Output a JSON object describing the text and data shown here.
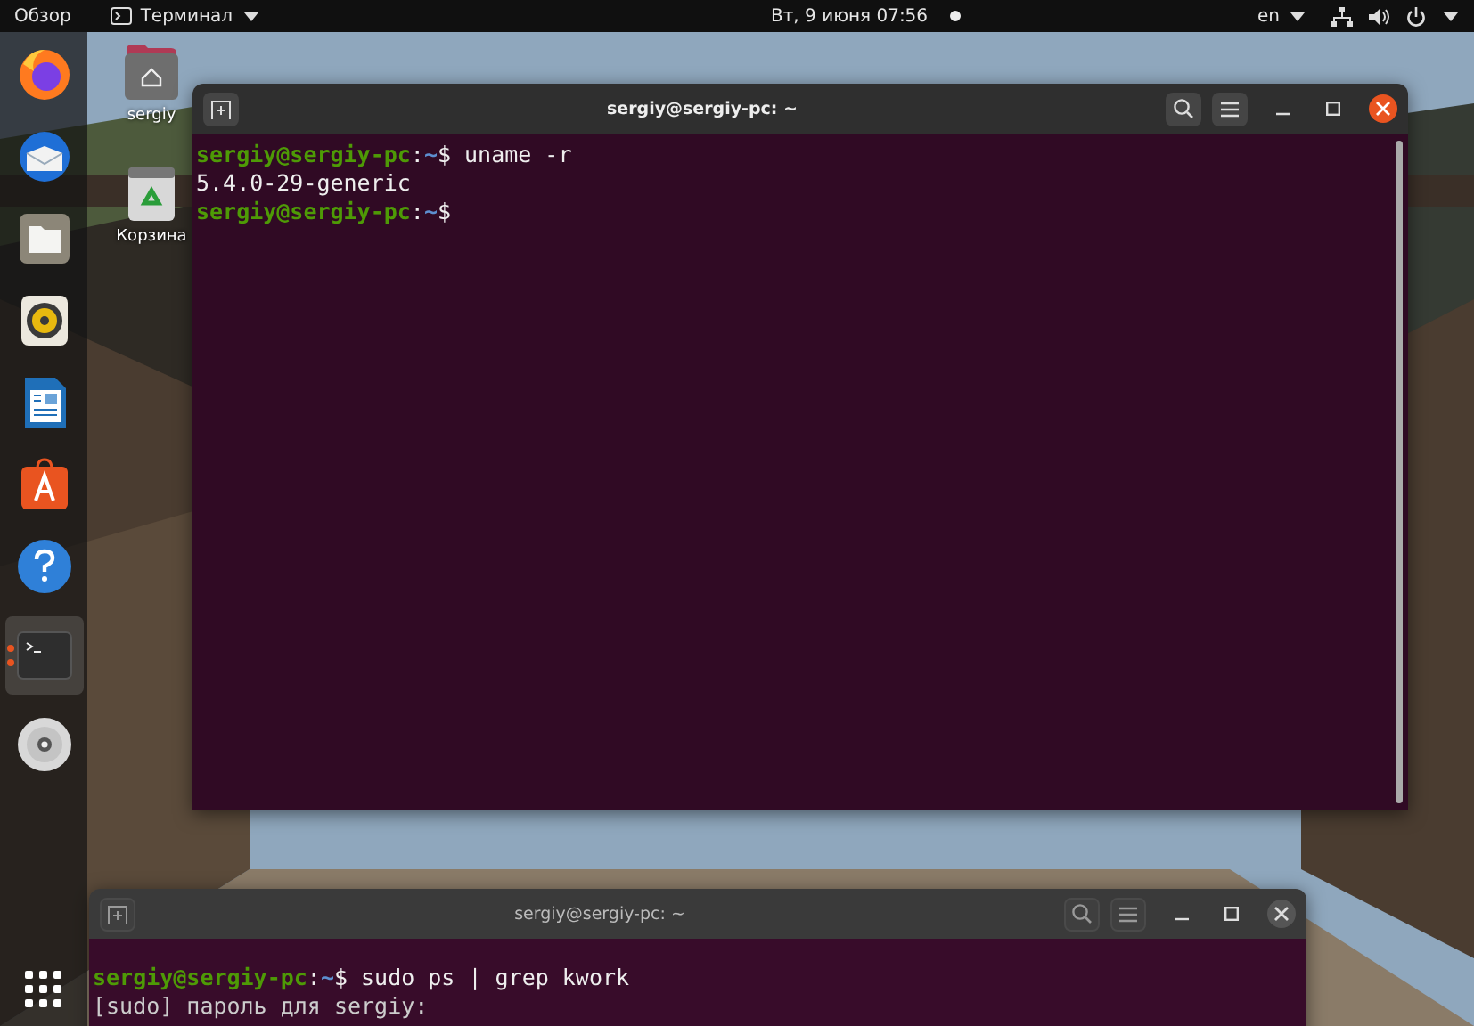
{
  "top_bar": {
    "activities": "Обзор",
    "app_menu": "Терминал",
    "clock": "Вт, 9 июня  07:56",
    "keyboard_layout": "en"
  },
  "dock": {
    "items": [
      {
        "kind": "browser",
        "selected": false
      },
      {
        "kind": "mail",
        "selected": false
      },
      {
        "kind": "files",
        "selected": false
      },
      {
        "kind": "music",
        "selected": false
      },
      {
        "kind": "writer",
        "selected": false
      },
      {
        "kind": "store",
        "selected": false
      },
      {
        "kind": "help",
        "selected": false
      },
      {
        "kind": "terminal",
        "selected": true
      },
      {
        "kind": "disc",
        "selected": false
      }
    ]
  },
  "desktop": {
    "icons": [
      {
        "kind": "home",
        "label": "sergiy"
      },
      {
        "kind": "trash",
        "label": "Корзина"
      }
    ]
  },
  "windows": [
    {
      "title": "sergiy@sergiy-pc: ~",
      "active": true,
      "lines": [
        {
          "kind": "prompt",
          "user": "sergiy@sergiy-pc",
          "sep": ":",
          "path": "~",
          "sigil": "$",
          "command": "uname -r"
        },
        {
          "kind": "output",
          "text": "5.4.0-29-generic"
        },
        {
          "kind": "prompt",
          "user": "sergiy@sergiy-pc",
          "sep": ":",
          "path": "~",
          "sigil": "$"
        }
      ]
    },
    {
      "title": "sergiy@sergiy-pc: ~",
      "active": false,
      "lines": [
        {
          "kind": "prompt",
          "user": "sergiy@sergiy-pc",
          "sep": ":",
          "path": "~",
          "sigil": "$",
          "command": "sudo ps | grep kwork"
        },
        {
          "kind": "output",
          "text": "[sudo] пароль для sergiy:"
        }
      ]
    }
  ]
}
